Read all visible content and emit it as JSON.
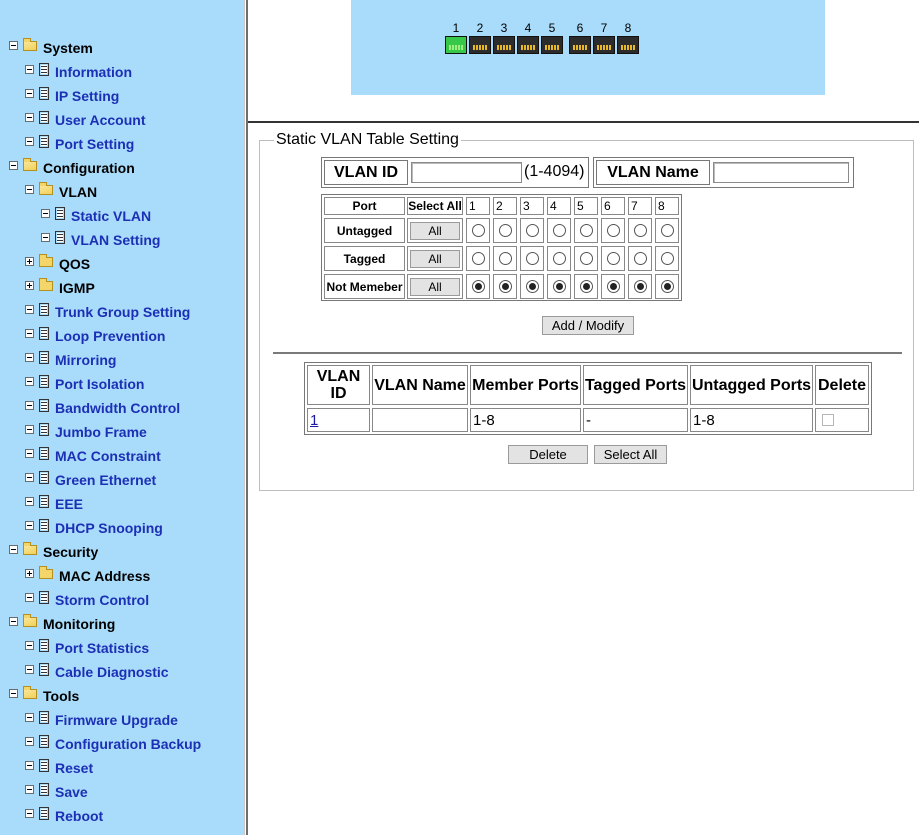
{
  "sidebar": {
    "items": [
      {
        "label": "System",
        "type": "category"
      },
      {
        "label": "Information",
        "type": "link"
      },
      {
        "label": "IP Setting",
        "type": "link"
      },
      {
        "label": "User Account",
        "type": "link"
      },
      {
        "label": "Port Setting",
        "type": "link"
      },
      {
        "label": "Configuration",
        "type": "category"
      },
      {
        "label": "VLAN",
        "type": "category"
      },
      {
        "label": "Static VLAN",
        "type": "link"
      },
      {
        "label": "VLAN Setting",
        "type": "link"
      },
      {
        "label": "QOS",
        "type": "category"
      },
      {
        "label": "IGMP",
        "type": "category"
      },
      {
        "label": "Trunk Group Setting",
        "type": "link"
      },
      {
        "label": "Loop Prevention",
        "type": "link"
      },
      {
        "label": "Mirroring",
        "type": "link"
      },
      {
        "label": "Port Isolation",
        "type": "link"
      },
      {
        "label": "Bandwidth Control",
        "type": "link"
      },
      {
        "label": "Jumbo Frame",
        "type": "link"
      },
      {
        "label": "MAC Constraint",
        "type": "link"
      },
      {
        "label": "Green Ethernet",
        "type": "link"
      },
      {
        "label": "EEE",
        "type": "link"
      },
      {
        "label": "DHCP Snooping",
        "type": "link"
      },
      {
        "label": "Security",
        "type": "category"
      },
      {
        "label": "MAC Address",
        "type": "category"
      },
      {
        "label": "Storm Control",
        "type": "link"
      },
      {
        "label": "Monitoring",
        "type": "category"
      },
      {
        "label": "Port Statistics",
        "type": "link"
      },
      {
        "label": "Cable Diagnostic",
        "type": "link"
      },
      {
        "label": "Tools",
        "type": "category"
      },
      {
        "label": "Firmware Upgrade",
        "type": "link"
      },
      {
        "label": "Configuration Backup",
        "type": "link"
      },
      {
        "label": "Reset",
        "type": "link"
      },
      {
        "label": "Save",
        "type": "link"
      },
      {
        "label": "Reboot",
        "type": "link"
      }
    ]
  },
  "banner": {
    "ports": [
      "1",
      "2",
      "3",
      "4",
      "5",
      "6",
      "7",
      "8"
    ],
    "active_port": "1",
    "colors": {
      "background": "#a8dcfa",
      "active_port": "#37c84a"
    }
  },
  "form": {
    "legend": "Static VLAN Table Setting",
    "vlan_id_label": "VLAN ID",
    "vlan_id_value": "",
    "vlan_id_range": "(1-4094)",
    "vlan_name_label": "VLAN Name",
    "vlan_name_value": "",
    "port_table": {
      "port_header": "Port",
      "select_all_header": "Select All",
      "ports": [
        "1",
        "2",
        "3",
        "4",
        "5",
        "6",
        "7",
        "8"
      ],
      "rows": [
        {
          "label": "Untagged",
          "all_button": "All",
          "selected": [
            false,
            false,
            false,
            false,
            false,
            false,
            false,
            false
          ]
        },
        {
          "label": "Tagged",
          "all_button": "All",
          "selected": [
            false,
            false,
            false,
            false,
            false,
            false,
            false,
            false
          ]
        },
        {
          "label": "Not Memeber",
          "all_button": "All",
          "selected": [
            true,
            true,
            true,
            true,
            true,
            true,
            true,
            true
          ]
        }
      ]
    },
    "add_modify_button": "Add / Modify"
  },
  "vlan_table": {
    "headers": [
      "VLAN ID",
      "VLAN Name",
      "Member Ports",
      "Tagged Ports",
      "Untagged Ports",
      "Delete"
    ],
    "rows": [
      {
        "vlan_id": "1",
        "vlan_name": "",
        "member_ports": "1-8",
        "tagged_ports": "-",
        "untagged_ports": "1-8",
        "delete_checked": false
      }
    ],
    "delete_button": "Delete",
    "select_all_button": "Select All"
  }
}
